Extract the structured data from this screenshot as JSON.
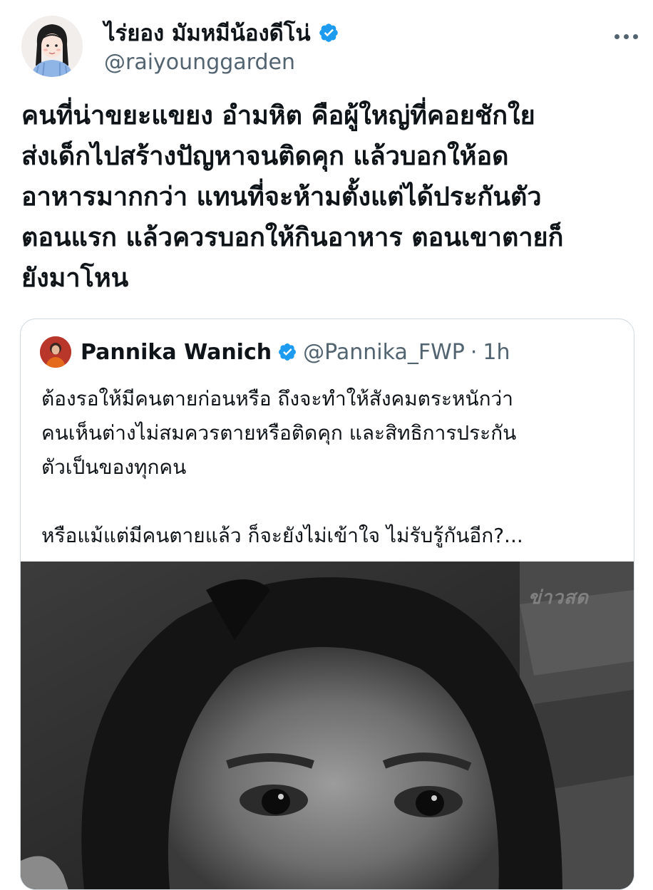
{
  "author": {
    "display_name": "ไร่ยอง มัมหมีน้องดีโน่",
    "handle": "@raiyounggarden",
    "avatar_icon": "cartoon-girl-avatar-icon",
    "verified": true
  },
  "tweet": {
    "text": "คนที่น่าขยะแขยง อำมหิต คือผู้ใหญ่ที่คอยชักใย\nส่งเด็กไปสร้างปัญหาจนติดคุก แล้วบอกให้อด\nอาหารมากกว่า แทนที่จะห้ามตั้งแต่ได้ประกันตัว\nตอนแรก แล้วควรบอกให้กินอาหาร ตอนเขาตายก็\nยังมาโหน"
  },
  "quoted": {
    "display_name": "Pannika Wanich",
    "handle": "@Pannika_FWP",
    "separator": "·",
    "time": "1h",
    "verified": true,
    "text": "ต้องรอให้มีคนตายก่อนหรือ ถึงจะทำให้สังคมตระหนักว่า\nคนเห็นต่างไม่สมควรตายหรือติดคุก และสิทธิการประกัน\nตัวเป็นของทุกคน",
    "text2": "หรือแม้แต่มีคนตายแล้ว ก็จะยังไม่เข้าใจ ไม่รับรู้กันอีก?...",
    "photo_watermark": "ข่าวสด"
  },
  "colors": {
    "verified_blue": "#1d9bf0",
    "secondary_text": "#536471",
    "border": "#cfd9de"
  }
}
